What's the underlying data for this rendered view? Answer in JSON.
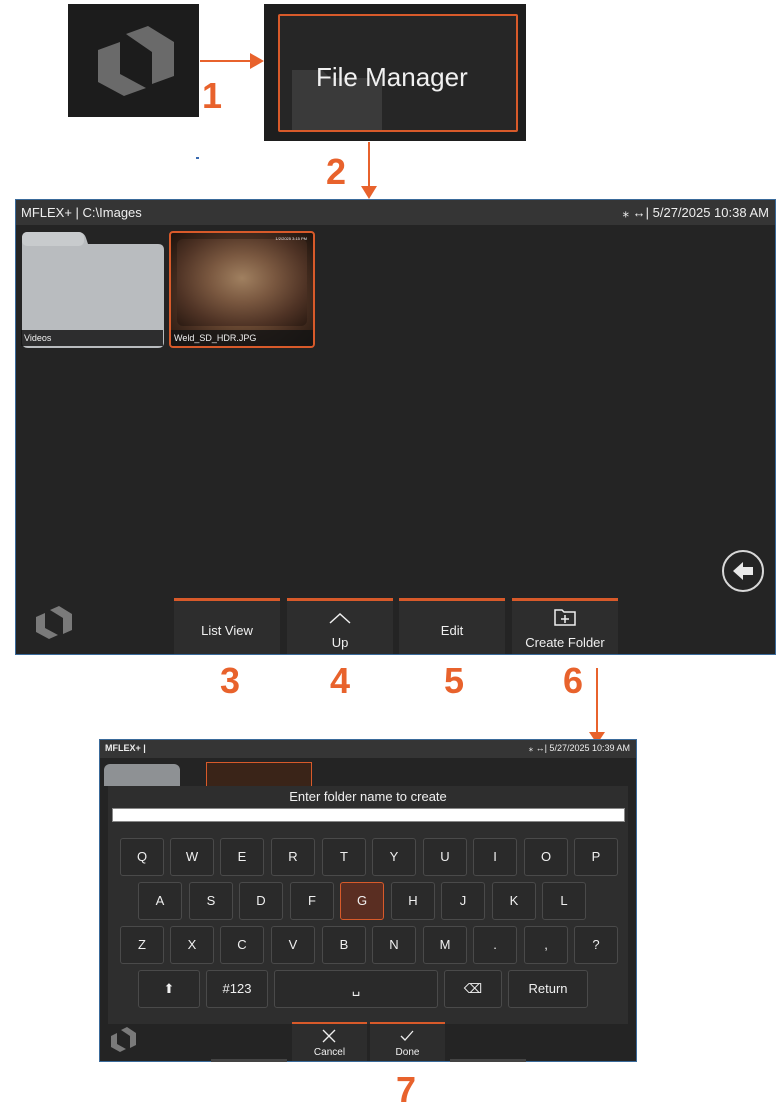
{
  "step_numbers": {
    "s1": "1",
    "s2": "2",
    "s3": "3",
    "s4": "4",
    "s5": "5",
    "s6": "6",
    "s7": "7"
  },
  "file_manager_tile": {
    "label": "File Manager"
  },
  "screen1": {
    "status_left": "MFLEX+ | C:\\Images",
    "status_right": "⁎ ↔| 5/27/2025  10:38 AM",
    "tiles": [
      {
        "caption": "Videos"
      },
      {
        "caption": "Weld_SD_HDR.JPG",
        "overlay": "1/2/2025  3:15 PM"
      }
    ],
    "softkeys": {
      "list_view": "List View",
      "up": "Up",
      "edit": "Edit",
      "create_folder": "Create Folder"
    }
  },
  "screen2": {
    "status_left": "MFLEX+ |",
    "status_right": "⁎ ↔| 5/27/2025  10:39 AM",
    "prompt": "Enter folder name to create",
    "input_value": "",
    "row1": [
      "Q",
      "W",
      "E",
      "R",
      "T",
      "Y",
      "U",
      "I",
      "O",
      "P"
    ],
    "row2": [
      "A",
      "S",
      "D",
      "F",
      "G",
      "H",
      "J",
      "K",
      "L"
    ],
    "row3": [
      "Z",
      "X",
      "C",
      "V",
      "B",
      "N",
      "M",
      ".",
      ",",
      "?"
    ],
    "row4": {
      "shift": "⬆",
      "numbers": "#123",
      "space": "␣",
      "backspace": "⌫",
      "return": "Return"
    },
    "softkeys": {
      "cancel": "Cancel",
      "done": "Done"
    }
  },
  "colors": {
    "accent": "#d85a2a",
    "step": "#e8622c",
    "screen_bg": "#242424"
  }
}
